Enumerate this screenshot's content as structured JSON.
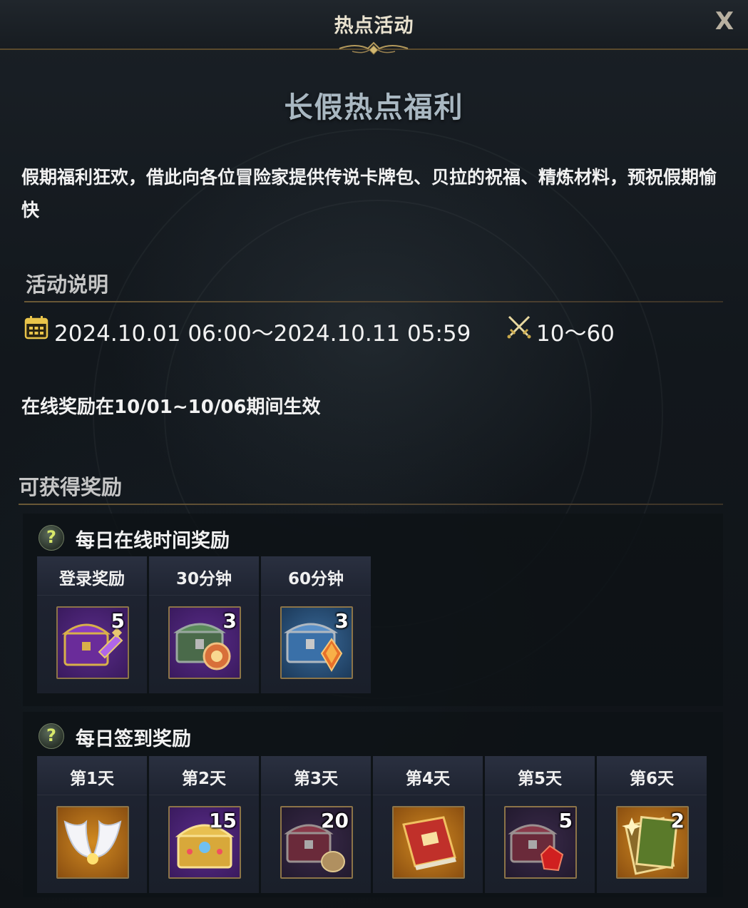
{
  "header": {
    "title": "热点活动",
    "close_label": "X"
  },
  "event": {
    "title": "长假热点福利",
    "description": "假期福利狂欢，借此向各位冒险家提供传说卡牌包、贝拉的祝福、精炼材料，预祝假期愉快"
  },
  "details": {
    "heading": "活动说明",
    "period": "2024.10.01 06:00～2024.10.11 05:59",
    "level_range": "10～60",
    "note": "在线奖励在10/01~10/06期间生效"
  },
  "rewards": {
    "heading": "可获得奖励",
    "online": {
      "label": "每日在线时间奖励",
      "help_icon": "question-icon",
      "slots": [
        {
          "label": "登录奖励",
          "qty": "5",
          "icon": "purple-chest-potion-icon",
          "rarity": "purple"
        },
        {
          "label": "30分钟",
          "qty": "3",
          "icon": "green-chest-gem-icon",
          "rarity": "purple"
        },
        {
          "label": "60分钟",
          "qty": "3",
          "icon": "blue-chest-crystal-icon",
          "rarity": "purple"
        }
      ]
    },
    "checkin": {
      "label": "每日签到奖励",
      "help_icon": "question-icon",
      "slots": [
        {
          "label": "第1天",
          "qty": "",
          "icon": "angel-wings-icon",
          "rarity": "orange"
        },
        {
          "label": "第2天",
          "qty": "15",
          "icon": "golden-chest-icon",
          "rarity": "purple"
        },
        {
          "label": "第3天",
          "qty": "20",
          "icon": "red-chest-bag-icon",
          "rarity": "dark"
        },
        {
          "label": "第4天",
          "qty": "",
          "icon": "spell-book-icon",
          "rarity": "orange"
        },
        {
          "label": "第5天",
          "qty": "5",
          "icon": "red-chest-crystal-icon",
          "rarity": "dark"
        },
        {
          "label": "第6天",
          "qty": "2",
          "icon": "card-pack-icon",
          "rarity": "orange"
        }
      ]
    }
  }
}
